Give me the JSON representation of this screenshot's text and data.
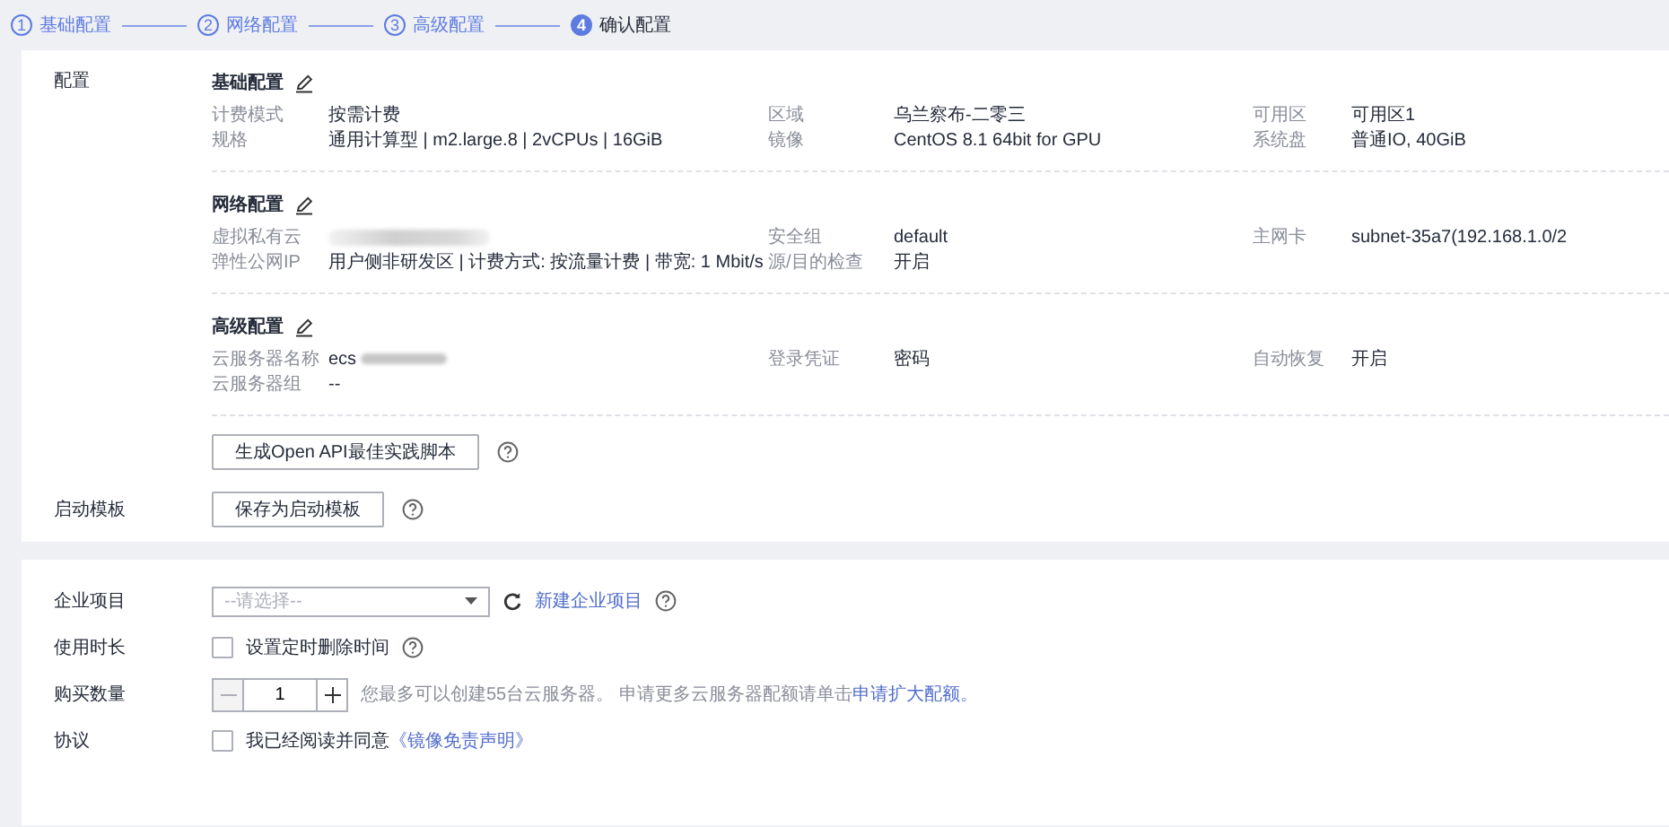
{
  "steps": [
    {
      "number": "1",
      "label": "基础配置",
      "selected": false
    },
    {
      "number": "2",
      "label": "网络配置",
      "selected": false
    },
    {
      "number": "3",
      "label": "高级配置",
      "selected": false
    },
    {
      "number": "4",
      "label": "确认配置",
      "selected": true
    }
  ],
  "config": {
    "label": "配置",
    "sections": [
      {
        "title": "基础配置",
        "rows": [
          [
            {
              "label": "计费模式",
              "value": "按需计费"
            },
            {
              "label": "区域",
              "value": "乌兰察布-二零三"
            },
            {
              "label": "可用区",
              "value": "可用区1"
            }
          ],
          [
            {
              "label": "规格",
              "value": "通用计算型 | m2.large.8 | 2vCPUs | 16GiB"
            },
            {
              "label": "镜像",
              "value": "CentOS 8.1 64bit for GPU"
            },
            {
              "label": "系统盘",
              "value": "普通IO, 40GiB"
            }
          ]
        ]
      },
      {
        "title": "网络配置",
        "rows": [
          [
            {
              "label": "虚拟私有云",
              "redacted": true
            },
            {
              "label": "安全组",
              "value": "default"
            },
            {
              "label": "主网卡",
              "value": "subnet-35a7(192.168.1.0/2"
            }
          ],
          [
            {
              "label": "弹性公网IP",
              "value": "用户侧非研发区 | 计费方式: 按流量计费 | 带宽: 1 Mbit/s"
            },
            {
              "label": "源/目的检查",
              "value": "开启"
            }
          ]
        ]
      },
      {
        "title": "高级配置",
        "rows": [
          [
            {
              "label": "云服务器名称",
              "value": "ecs",
              "redacted": true
            },
            {
              "label": "登录凭证",
              "value": "密码"
            },
            {
              "label": "自动恢复",
              "value": "开启"
            }
          ],
          [
            {
              "label": "云服务器组",
              "value": "--"
            }
          ]
        ]
      }
    ],
    "api_button": "生成Open API最佳实践脚本"
  },
  "launch_template": {
    "label": "启动模板",
    "button": "保存为启动模板"
  },
  "enterprise_project": {
    "label": "企业项目",
    "placeholder": "--请选择--",
    "link": "新建企业项目"
  },
  "duration": {
    "label": "使用时长",
    "checkbox_label": "设置定时删除时间",
    "checked": false
  },
  "quantity": {
    "label": "购买数量",
    "value": "1",
    "minus_disabled": true,
    "hint": "您最多可以创建55台云服务器。 申请更多云服务器配额请单击",
    "link": "申请扩大配额。"
  },
  "agreement": {
    "label": "协议",
    "checked": false,
    "text": "我已经阅读并同意",
    "link": "《镜像免责声明》"
  }
}
